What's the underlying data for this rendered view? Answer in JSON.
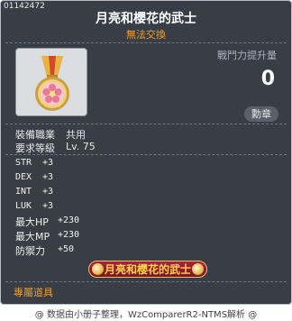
{
  "item": {
    "id": "01142472",
    "name": "月亮和櫻花的武士",
    "trade_status": "無法交換",
    "combat_power_label": "戰鬥力提升量",
    "combat_power_value": "0",
    "medal_button": "勳章",
    "icon": "medal-icon"
  },
  "requirements": [
    {
      "label": "裝備職業",
      "value": "共用"
    },
    {
      "label": "要求等級",
      "value": "Lv. 75"
    }
  ],
  "stats": [
    {
      "label": "STR",
      "value": "+3"
    },
    {
      "label": "DEX",
      "value": "+3"
    },
    {
      "label": "INT",
      "value": "+3"
    },
    {
      "label": "LUK",
      "value": "+3"
    },
    {
      "label": "最大HP",
      "value": "+230"
    },
    {
      "label": "最大MP",
      "value": "+230"
    },
    {
      "label": "防禦力",
      "value": "+50"
    }
  ],
  "banner": {
    "text": "月亮和櫻花的武士"
  },
  "exclusive_label": "專屬道具",
  "footer": "@ 数据由小册子整理，WzComparerR2-NTMS解析 @",
  "colors": {
    "background": "#383d46",
    "gold": "#f0a020",
    "border": "#b8bcc4",
    "banner": "#9a1f33"
  }
}
